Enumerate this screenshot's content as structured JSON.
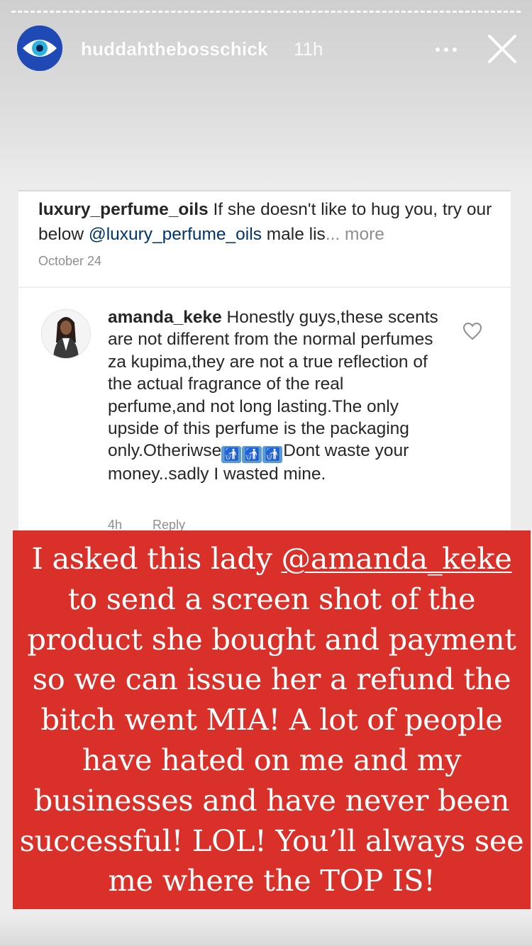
{
  "story": {
    "username": "huddahthebosschick",
    "time_ago": "11h",
    "icons": {
      "more": "more-horizontal-icon",
      "close": "close-icon",
      "avatar": "eye-logo-icon"
    }
  },
  "screenshot": {
    "post": {
      "author": "luxury_perfume_oils",
      "text_before": " If she doesn't like to hug you,  try our below ",
      "mention": "@luxury_perfume_oils",
      "text_after": " male lis",
      "more": "... more",
      "date": "October 24"
    },
    "comment": {
      "author": "amanda_keke",
      "text": " Honestly guys,these scents are not different from the normal perfumes za kupima,they are not a true reflection of the actual fragrance of the real perfume,and not long lasting.The only upside of this perfume is the packaging only.Otheriwse",
      "text_end": "Dont waste your money..sadly I wasted mine.",
      "emoji": "🚮",
      "time": "4h",
      "reply": "Reply",
      "heart_icon": "heart-icon"
    }
  },
  "caption": {
    "before": "I asked this lady ",
    "mention": "@amanda_keke",
    "after": " to send a screen shot of the product she bought and payment so we can issue her a refund the bitch went MIA! A lot of people have hated on me and my businesses and have never been successful! LOL! You’ll always see me where the TOP IS!",
    "background": "#d9312a"
  }
}
